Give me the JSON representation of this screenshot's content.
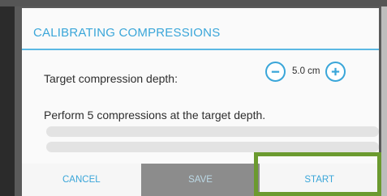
{
  "dialog": {
    "title": "CALIBRATING COMPRESSIONS",
    "depth_label": "Target compression depth:",
    "depth_value": "5.0 cm",
    "instruction": "Perform 5 compressions at the target depth.",
    "actions": {
      "cancel": "CANCEL",
      "middle": "SAVE",
      "start": "START"
    }
  },
  "icons": {
    "decrement": "minus-circle-icon",
    "increment": "plus-circle-icon"
  },
  "colors": {
    "accent": "#3aa6d9",
    "highlight": "#6b9a2f"
  }
}
